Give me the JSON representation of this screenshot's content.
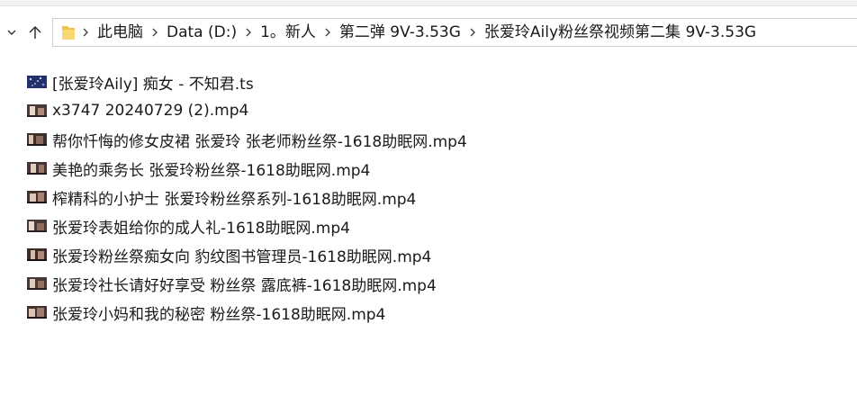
{
  "breadcrumb": {
    "items": [
      "此电脑",
      "Data (D:)",
      "1。新人",
      "第二弹 9V-3.53G",
      "张爱玲Aily粉丝祭视频第二集  9V-3.53G"
    ]
  },
  "icons": {
    "back_dropdown": "chevron-down-icon",
    "up": "arrow-up-icon",
    "folder": "folder-icon",
    "separator": "chevron-right-icon",
    "ts_file": "ts-video-thumbnail-icon",
    "mp4_file": "video-thumbnail-icon"
  },
  "colors": {
    "folder": "#f2c04a",
    "ts_thumb": "#24306a",
    "mp4_thumb": "#4a3a36"
  },
  "files": [
    {
      "name": "[张爱玲Aily] 痴女 - 不知君.ts",
      "kind": "ts"
    },
    {
      "name": "x3747 20240729 (2).mp4",
      "kind": "mp4"
    },
    {
      "name": "帮你忏悔的修女皮裙 张爱玲 张老师粉丝祭-1618助眠网.mp4",
      "kind": "mp4"
    },
    {
      "name": "美艳的乘务长 张爱玲粉丝祭-1618助眠网.mp4",
      "kind": "mp4"
    },
    {
      "name": "榨精科的小护士 张爱玲粉丝祭系列-1618助眠网.mp4",
      "kind": "mp4"
    },
    {
      "name": "张爱玲表姐给你的成人礼-1618助眠网.mp4",
      "kind": "mp4"
    },
    {
      "name": "张爱玲粉丝祭痴女向 豹纹图书管理员-1618助眠网.mp4",
      "kind": "mp4"
    },
    {
      "name": "张爱玲社长请好好享受 粉丝祭 露底裤-1618助眠网.mp4",
      "kind": "mp4"
    },
    {
      "name": "张爱玲小妈和我的秘密 粉丝祭-1618助眠网.mp4",
      "kind": "mp4"
    }
  ]
}
